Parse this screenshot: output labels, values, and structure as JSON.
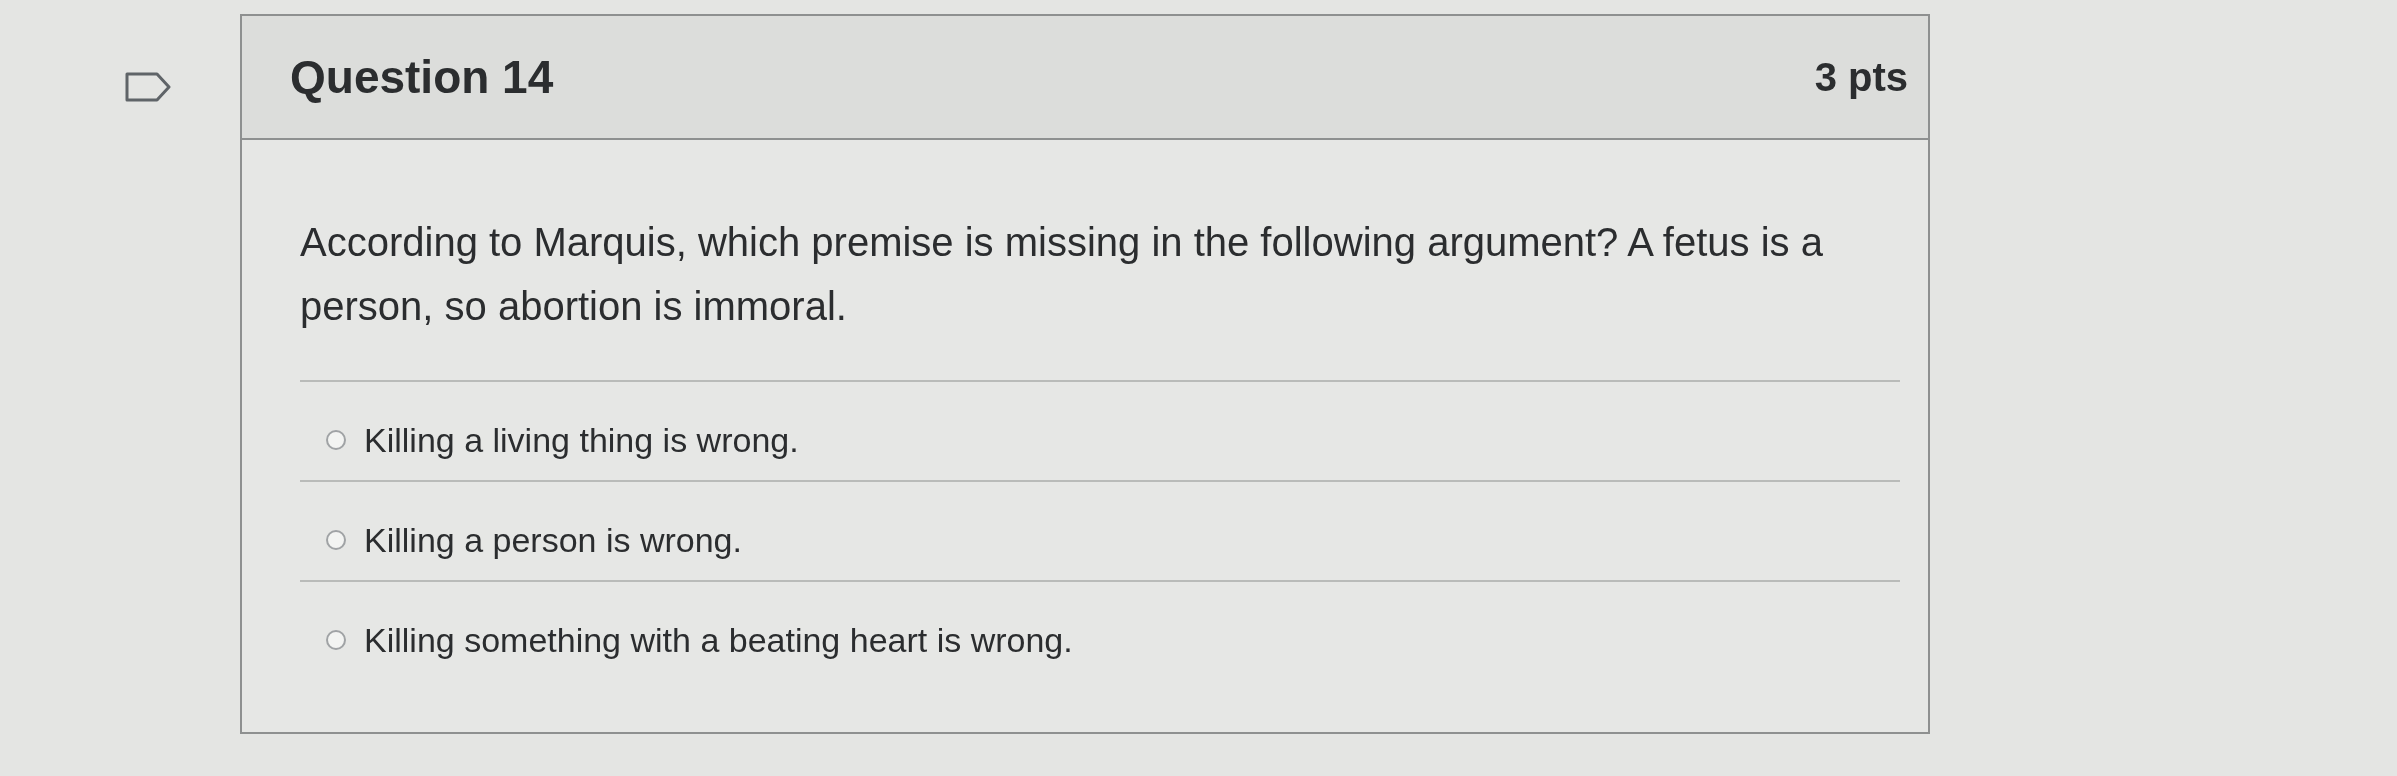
{
  "question": {
    "flagged": false,
    "title": "Question 14",
    "points": "3 pts",
    "text": "According to Marquis, which premise is missing in the following argument? A fetus is a person, so abortion is immoral.",
    "answers": [
      {
        "label": "Killing a living thing is wrong.",
        "selected": false
      },
      {
        "label": "Killing a person is wrong.",
        "selected": false
      },
      {
        "label": "Killing something with a beating heart is wrong.",
        "selected": false
      }
    ]
  }
}
